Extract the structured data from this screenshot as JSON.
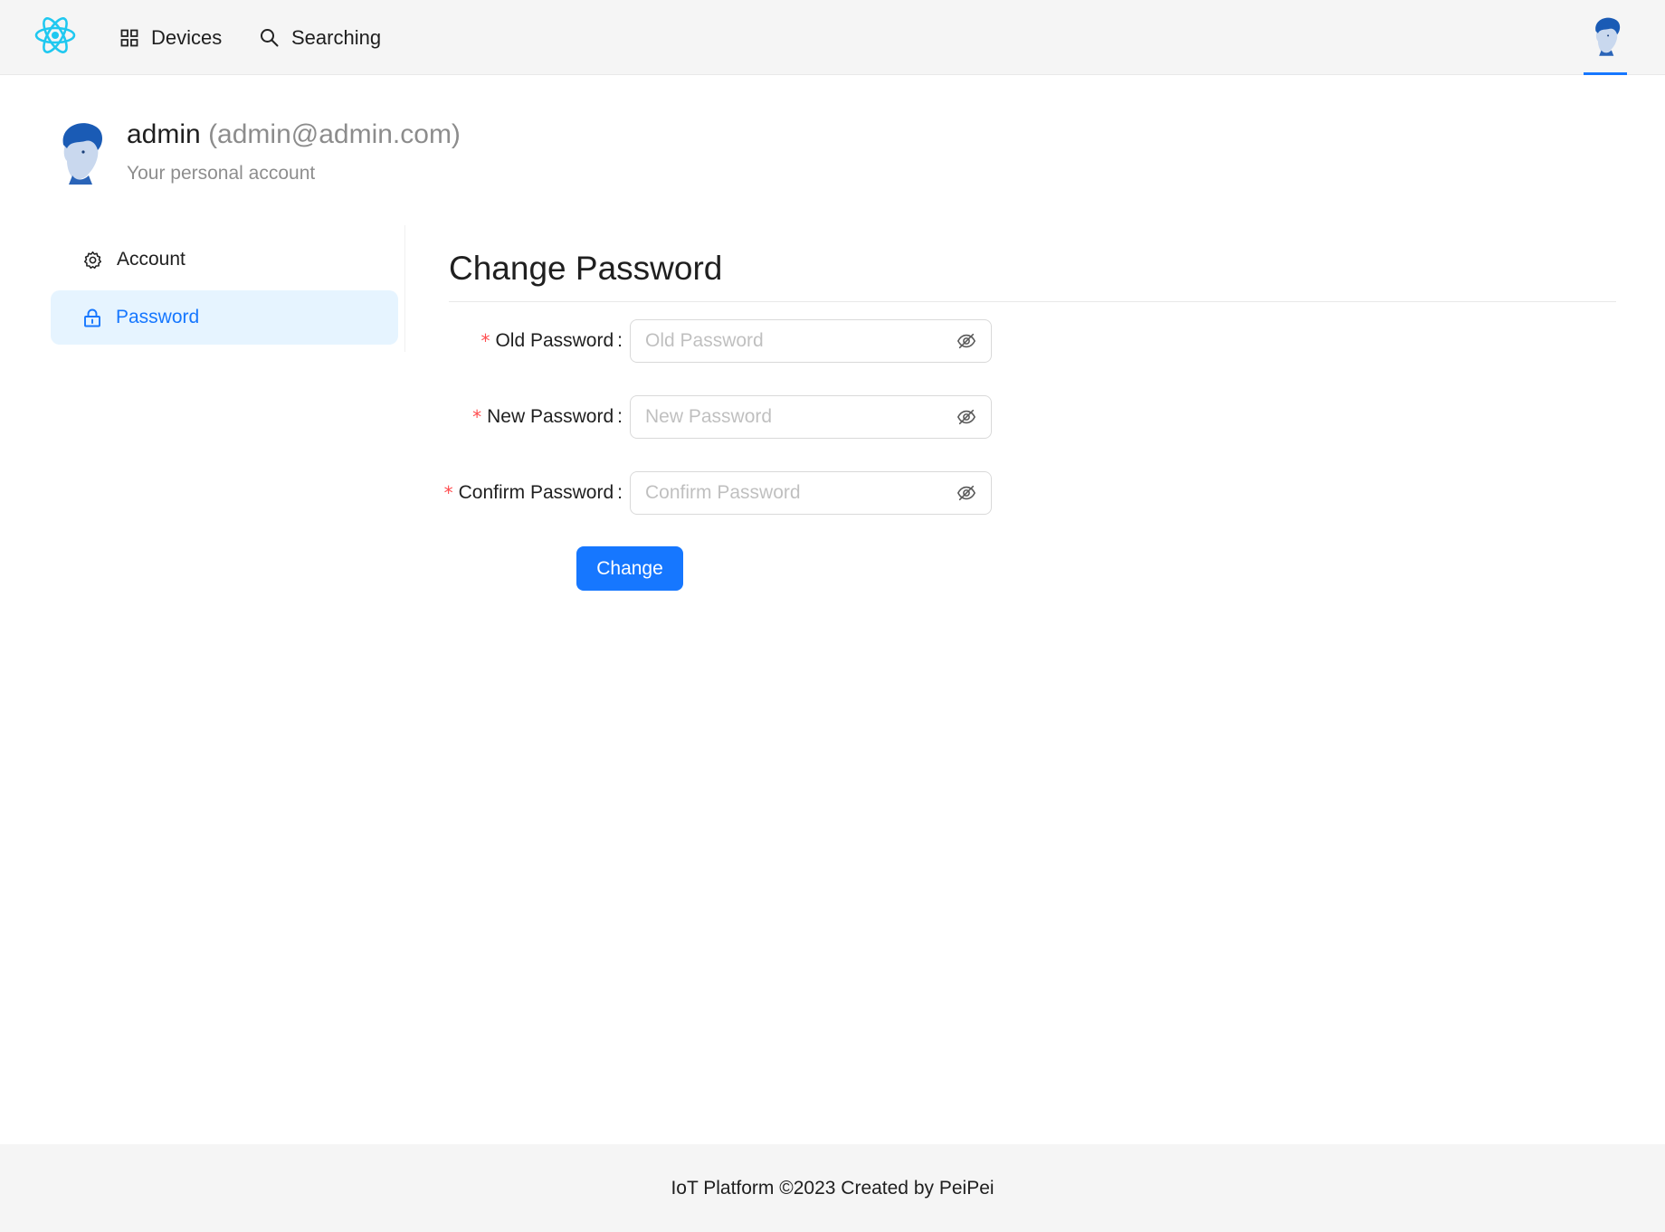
{
  "nav": {
    "logo_icon": "react-atom-icon",
    "items": [
      {
        "label": "Devices",
        "icon": "appstore-icon"
      },
      {
        "label": "Searching",
        "icon": "search-icon"
      }
    ],
    "active_indicator_color": "#1677ff"
  },
  "profile": {
    "name": "admin",
    "email": "(admin@admin.com)",
    "subtitle": "Your personal account"
  },
  "sidebar": {
    "items": [
      {
        "label": "Account",
        "icon": "gear-icon",
        "selected": false
      },
      {
        "label": "Password",
        "icon": "lock-icon",
        "selected": true
      }
    ]
  },
  "form": {
    "title": "Change Password",
    "fields": [
      {
        "label": "Old Password",
        "placeholder": "Old Password",
        "value": "",
        "required": true
      },
      {
        "label": "New Password",
        "placeholder": "New Password",
        "value": "",
        "required": true
      },
      {
        "label": "Confirm Password",
        "placeholder": "Confirm Password",
        "value": "",
        "required": true
      }
    ],
    "required_mark": "*",
    "colon": ":",
    "submit_label": "Change"
  },
  "footer": {
    "text": "IoT Platform ©2023 Created by PeiPei"
  },
  "colors": {
    "primary": "#1677ff",
    "selected_bg": "#e6f4ff",
    "required": "#ff4d4f",
    "logo": "#1fc8f0"
  }
}
